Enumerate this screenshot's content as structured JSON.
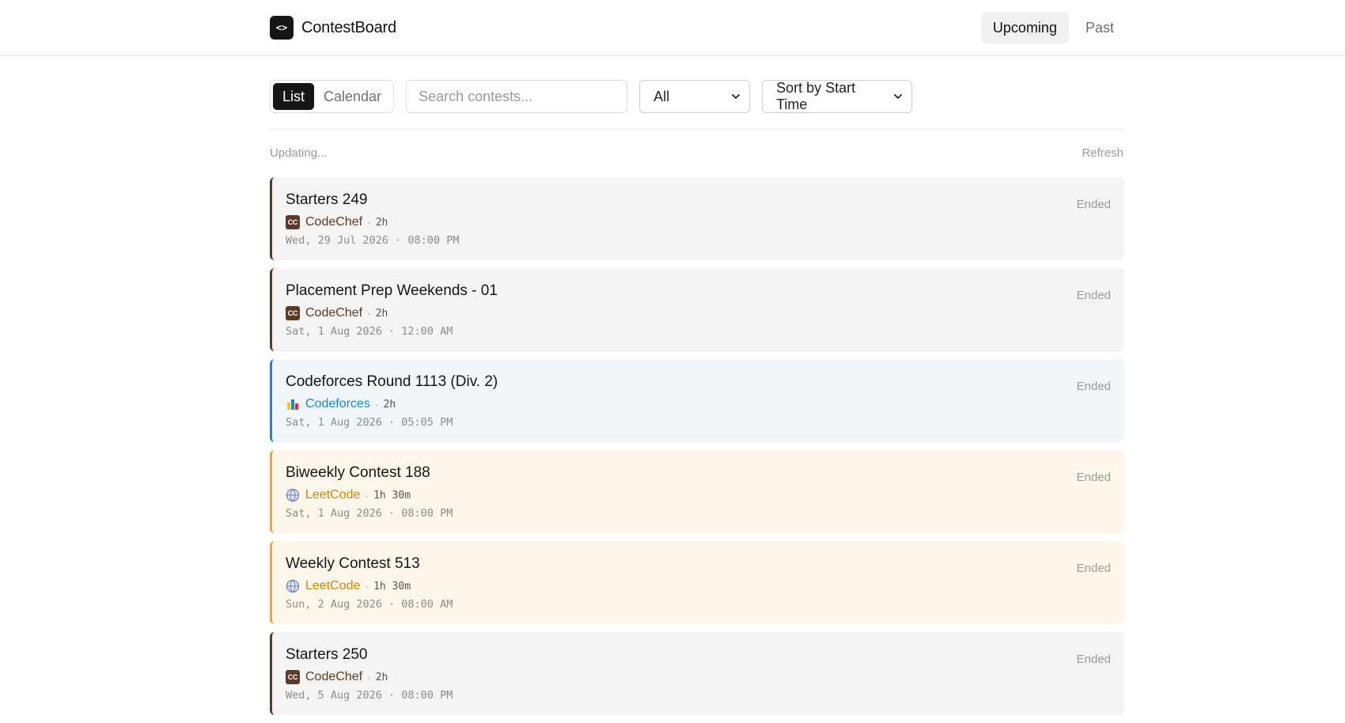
{
  "brand": {
    "name": "ContestBoard",
    "logo_glyph": "<>"
  },
  "nav": {
    "items": [
      {
        "label": "Upcoming",
        "active": true
      },
      {
        "label": "Past",
        "active": false
      }
    ]
  },
  "toolbar": {
    "view_toggle": [
      {
        "label": "List",
        "active": true
      },
      {
        "label": "Calendar",
        "active": false
      }
    ],
    "search_placeholder": "Search contests...",
    "platform_filter": "All",
    "sort": "Sort by Start Time"
  },
  "status": {
    "text": "Updating...",
    "refresh_label": "Refresh"
  },
  "platform_colors": {
    "codechef": "#5b3a29",
    "codeforces": "#1b88c5",
    "leetcode": "#f0a72b"
  },
  "contests": [
    {
      "title": "Starters 249",
      "platform": "CodeChef",
      "platform_key": "codechef",
      "icon": "codechef-icon",
      "duration": "2h",
      "date": "Wed, 29 Jul 2026 · 08:00 PM",
      "status": "Ended"
    },
    {
      "title": "Placement Prep Weekends - 01",
      "platform": "CodeChef",
      "platform_key": "codechef",
      "icon": "codechef-icon",
      "duration": "2h",
      "date": "Sat, 1 Aug 2026 · 12:00 AM",
      "status": "Ended"
    },
    {
      "title": "Codeforces Round 1113 (Div. 2)",
      "platform": "Codeforces",
      "platform_key": "codeforces",
      "icon": "codeforces-icon",
      "duration": "2h",
      "date": "Sat, 1 Aug 2026 · 05:05 PM",
      "status": "Ended"
    },
    {
      "title": "Biweekly Contest 188",
      "platform": "LeetCode",
      "platform_key": "leetcode",
      "icon": "leetcode-icon",
      "duration": "1h 30m",
      "date": "Sat, 1 Aug 2026 · 08:00 PM",
      "status": "Ended"
    },
    {
      "title": "Weekly Contest 513",
      "platform": "LeetCode",
      "platform_key": "leetcode",
      "icon": "leetcode-icon",
      "duration": "1h 30m",
      "date": "Sun, 2 Aug 2026 · 08:00 AM",
      "status": "Ended"
    },
    {
      "title": "Starters 250",
      "platform": "CodeChef",
      "platform_key": "codechef",
      "icon": "codechef-icon",
      "duration": "2h",
      "date": "Wed, 5 Aug 2026 · 08:00 PM",
      "status": "Ended"
    }
  ]
}
